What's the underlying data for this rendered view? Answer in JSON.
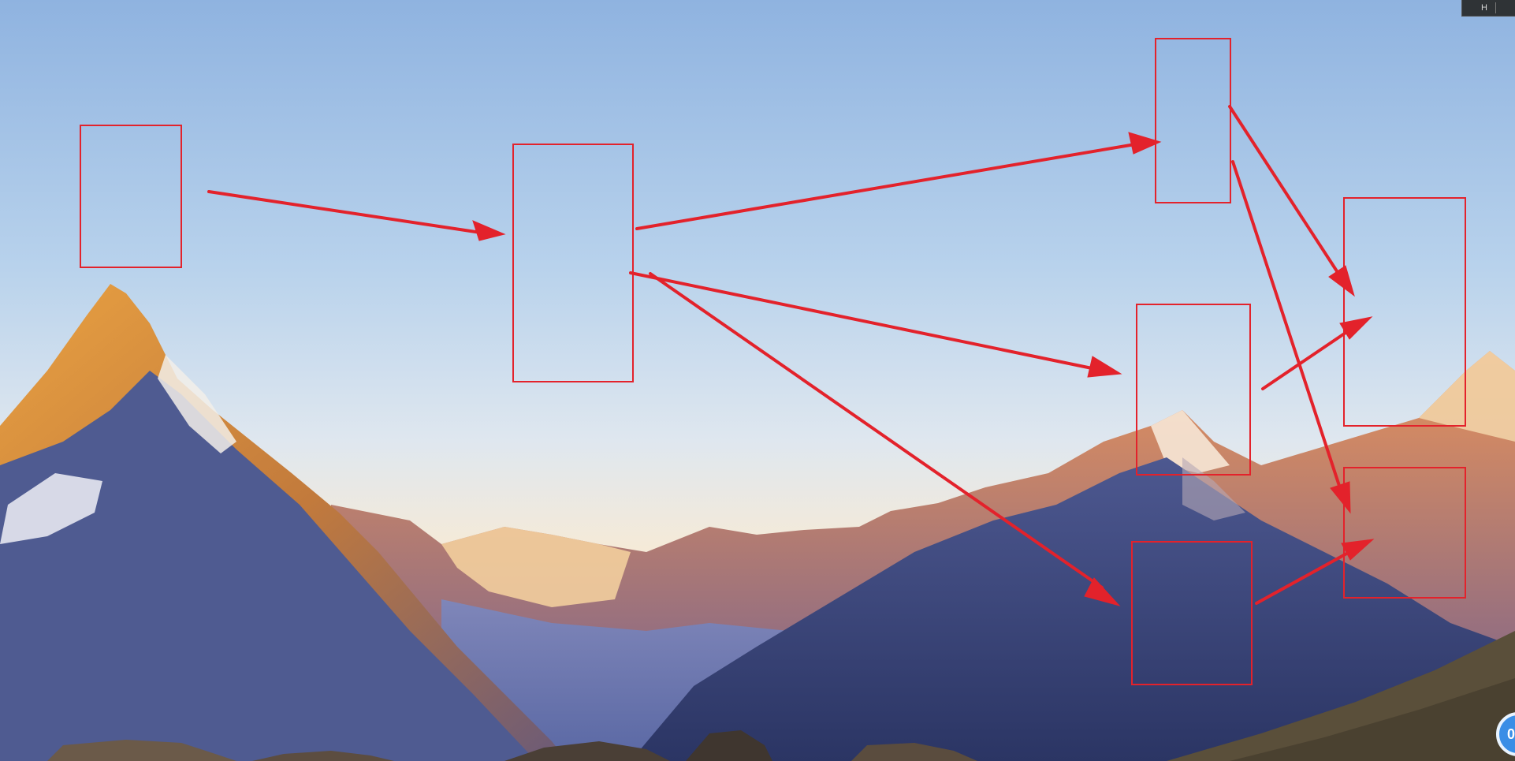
{
  "canvas": {
    "sky_colors": [
      "#8fb3e0",
      "#b8d2ec",
      "#dfe7ef",
      "#f5ead8"
    ],
    "annotation_color": "#e3222b"
  },
  "corner_tab": {
    "label": "H"
  },
  "bubble": {
    "label": "0"
  }
}
